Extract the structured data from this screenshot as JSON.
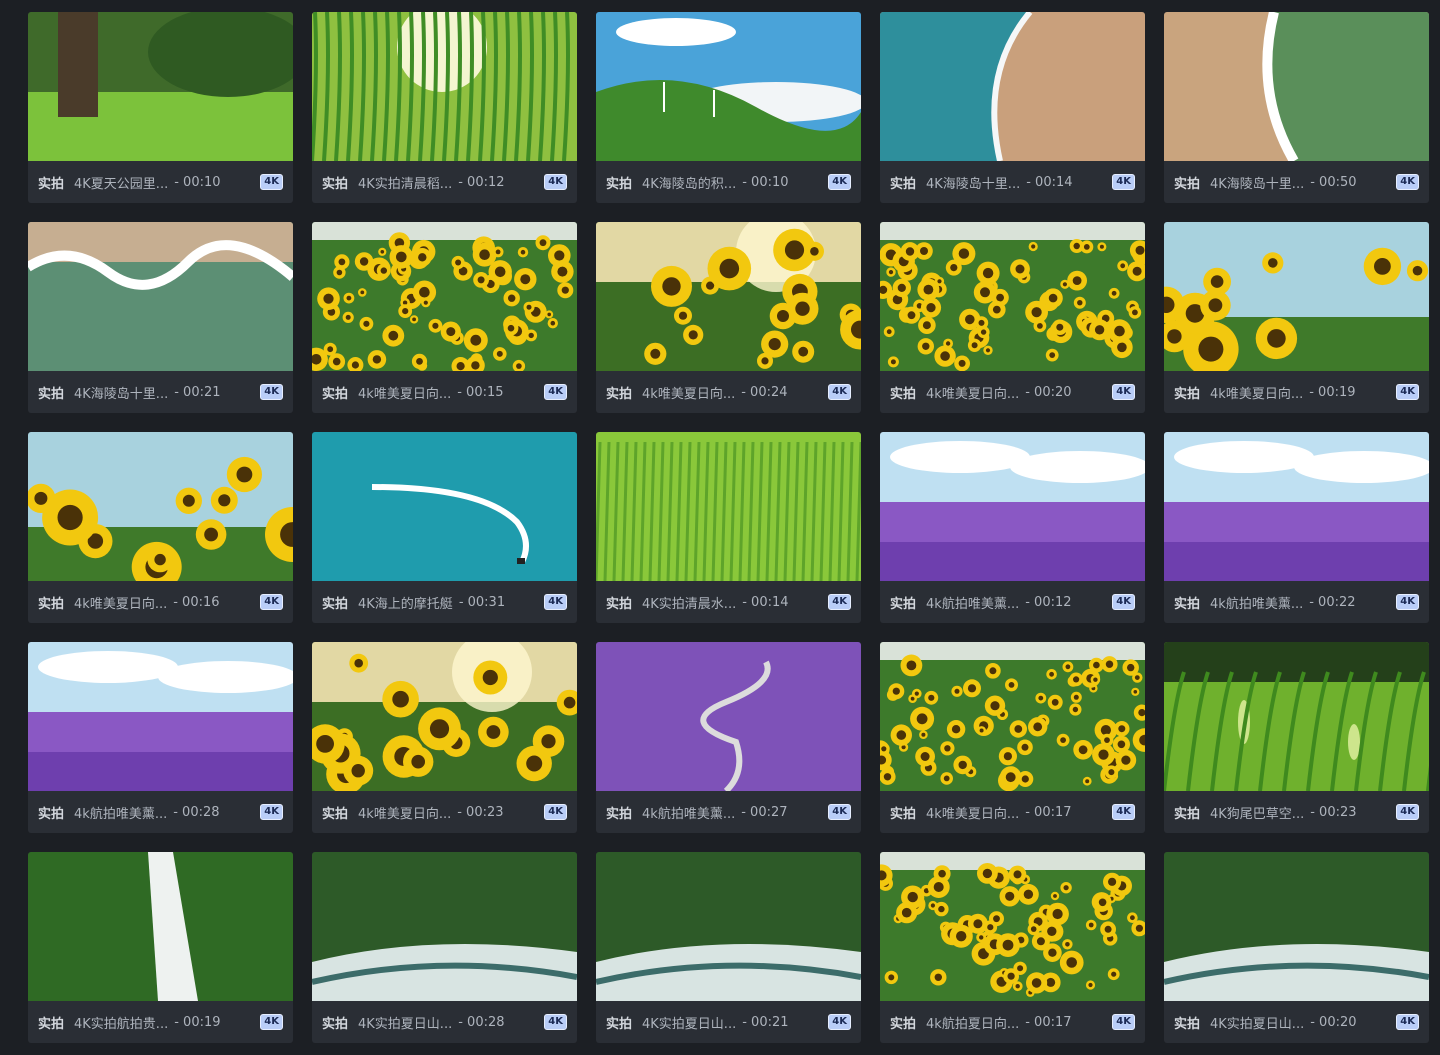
{
  "labels": {
    "tag": "实拍",
    "badge": "4K"
  },
  "videos": [
    {
      "title": "4K夏天公园里...",
      "duration": "- 00:10",
      "theme": "park"
    },
    {
      "title": "4K实拍清晨稻...",
      "duration": "- 00:12",
      "theme": "grass-sun"
    },
    {
      "title": "4K海陵岛的积...",
      "duration": "- 00:10",
      "theme": "hills-wind"
    },
    {
      "title": "4K海陵岛十里...",
      "duration": "- 00:14",
      "theme": "beach"
    },
    {
      "title": "4K海陵岛十里...",
      "duration": "- 00:50",
      "theme": "beach-aerial"
    },
    {
      "title": "4K海陵岛十里...",
      "duration": "- 00:21",
      "theme": "waves"
    },
    {
      "title": "4k唯美夏日向...",
      "duration": "- 00:15",
      "theme": "sunflowers"
    },
    {
      "title": "4k唯美夏日向...",
      "duration": "- 00:24",
      "theme": "sunflowers-sun"
    },
    {
      "title": "4k唯美夏日向...",
      "duration": "- 00:20",
      "theme": "sunflowers"
    },
    {
      "title": "4k唯美夏日向...",
      "duration": "- 00:19",
      "theme": "sunflowers-sky"
    },
    {
      "title": "4k唯美夏日向...",
      "duration": "- 00:16",
      "theme": "sunflowers-sky"
    },
    {
      "title": "4K海上的摩托艇",
      "duration": "- 00:31",
      "theme": "sea-boat"
    },
    {
      "title": "4K实拍清晨水...",
      "duration": "- 00:14",
      "theme": "rice"
    },
    {
      "title": "4k航拍唯美薰...",
      "duration": "- 00:12",
      "theme": "lavender"
    },
    {
      "title": "4k航拍唯美薰...",
      "duration": "- 00:22",
      "theme": "lavender"
    },
    {
      "title": "4k航拍唯美薰...",
      "duration": "- 00:28",
      "theme": "lavender"
    },
    {
      "title": "4k唯美夏日向...",
      "duration": "- 00:23",
      "theme": "sunflowers-sun"
    },
    {
      "title": "4k航拍唯美薰...",
      "duration": "- 00:27",
      "theme": "lavender-path"
    },
    {
      "title": "4k唯美夏日向...",
      "duration": "- 00:17",
      "theme": "sunflowers"
    },
    {
      "title": "4K狗尾巴草空...",
      "duration": "- 00:23",
      "theme": "foxtail"
    },
    {
      "title": "4K实拍航拍贵...",
      "duration": "- 00:19",
      "theme": "waterfall"
    },
    {
      "title": "4K实拍夏日山...",
      "duration": "- 00:28",
      "theme": "river"
    },
    {
      "title": "4K实拍夏日山...",
      "duration": "- 00:21",
      "theme": "river"
    },
    {
      "title": "4k航拍夏日向...",
      "duration": "- 00:17",
      "theme": "sunflowers"
    },
    {
      "title": "4K实拍夏日山...",
      "duration": "- 00:20",
      "theme": "river"
    }
  ]
}
